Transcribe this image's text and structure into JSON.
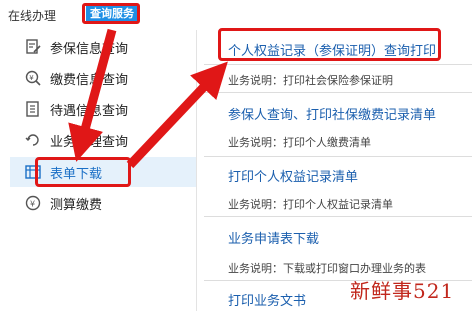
{
  "header": {
    "online_tab": "在线办理",
    "query_tab": "查询服务"
  },
  "sidebar": {
    "items": [
      {
        "label": "参保信息查询",
        "icon": "document-edit-icon"
      },
      {
        "label": "缴费信息查询",
        "icon": "money-search-icon"
      },
      {
        "label": "待遇信息查询",
        "icon": "document-list-icon"
      },
      {
        "label": "业务办理查询",
        "icon": "refresh-doc-icon"
      },
      {
        "label": "表单下载",
        "icon": "form-table-icon",
        "active": true
      },
      {
        "label": "测算缴费",
        "icon": "calculator-coin-icon"
      }
    ]
  },
  "main": {
    "rows": [
      {
        "title": "个人权益记录（参保证明）查询打印",
        "desc": "业务说明：打印社会保险参保证明"
      },
      {
        "title": "参保人查询、打印社保缴费记录清单",
        "desc": "业务说明：打印个人缴费清单"
      },
      {
        "title": "打印个人权益记录清单",
        "desc": "业务说明：打印个人权益记录清单"
      },
      {
        "title": "业务申请表下载",
        "desc": "业务说明：下载或打印窗口办理业务的表"
      },
      {
        "title": "打印业务文书",
        "desc": ""
      }
    ]
  },
  "watermark": "新鲜事521",
  "colors": {
    "accent": "#1f8fe5",
    "highlight": "#e01717",
    "link": "#1b5fae"
  }
}
